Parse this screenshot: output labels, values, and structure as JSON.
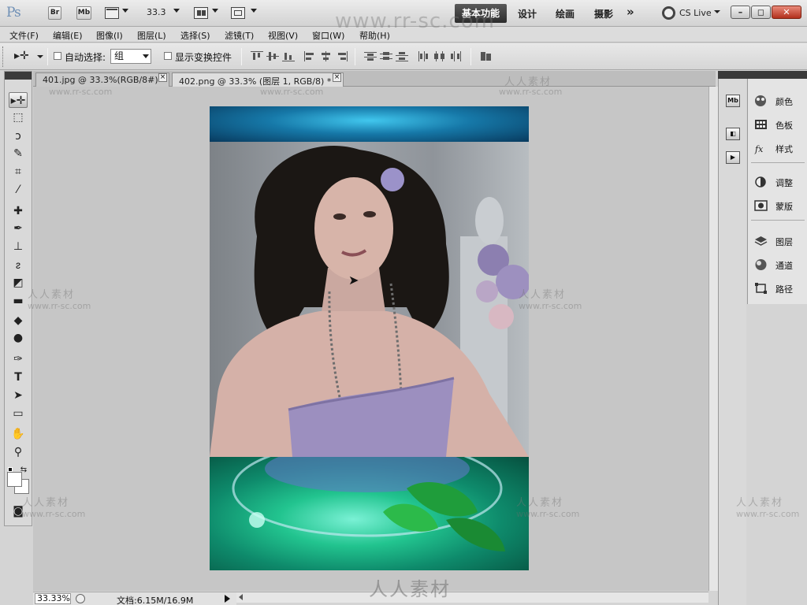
{
  "appbar": {
    "logo": "Ps",
    "bridge": "Br",
    "minibridge": "Mb",
    "zoom": "33.3",
    "workspace_active": "基本功能",
    "workspaces": [
      "设计",
      "绘画",
      "摄影"
    ],
    "more": "»",
    "cslive": "CS Live"
  },
  "menu": [
    "文件(F)",
    "编辑(E)",
    "图像(I)",
    "图层(L)",
    "选择(S)",
    "滤镜(T)",
    "视图(V)",
    "窗口(W)",
    "帮助(H)"
  ],
  "options": {
    "auto_select_label": "自动选择:",
    "auto_select_value": "组",
    "show_transform_label": "显示变换控件"
  },
  "tabs": [
    {
      "label": "401.jpg @ 33.3%(RGB/8#)"
    },
    {
      "label": "402.png @ 33.3% (图层 1, RGB/8) *"
    }
  ],
  "panels": [
    {
      "label": "颜色",
      "icon": "color-icon"
    },
    {
      "label": "色板",
      "icon": "swatches-icon"
    },
    {
      "label": "样式",
      "icon": "styles-icon"
    },
    {
      "label": "调整",
      "icon": "adjustments-icon"
    },
    {
      "label": "蒙版",
      "icon": "masks-icon"
    },
    {
      "label": "图层",
      "icon": "layers-icon"
    },
    {
      "label": "通道",
      "icon": "channels-icon"
    },
    {
      "label": "路径",
      "icon": "paths-icon"
    }
  ],
  "dock_icons": [
    "Mb"
  ],
  "status": {
    "zoom": "33.33%",
    "doc_info": "文档:6.15M/16.9M"
  },
  "watermark": {
    "site": "www.rr-sc.com",
    "cn": "人人素材"
  }
}
